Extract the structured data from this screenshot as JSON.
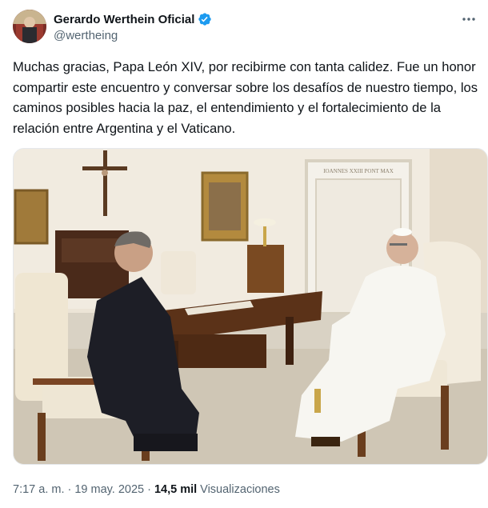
{
  "account": {
    "display_name": "Gerardo Werthein Oficial",
    "handle": "@wertheing",
    "verified": true,
    "verified_color": "#1d9bf0"
  },
  "post": {
    "text": "Muchas gracias, Papa León XIV, por recibirme con tanta calidez. Fue un honor compartir este encuentro y conversar sobre los desafíos de nuestro tiempo, los caminos posibles hacia la paz, el entendimiento y el fortalecimiento de la relación entre Argentina y el Vaticano.",
    "media_inscription": "IOANNES XXIII PONT MAX",
    "time": "7:17 a. m.",
    "separator": "·",
    "date": "19 may. 2025",
    "views_count": "14,5 mil",
    "views_label": "Visualizaciones"
  },
  "icons": {
    "verified": "verified-badge-icon",
    "more": "more-options-icon"
  }
}
